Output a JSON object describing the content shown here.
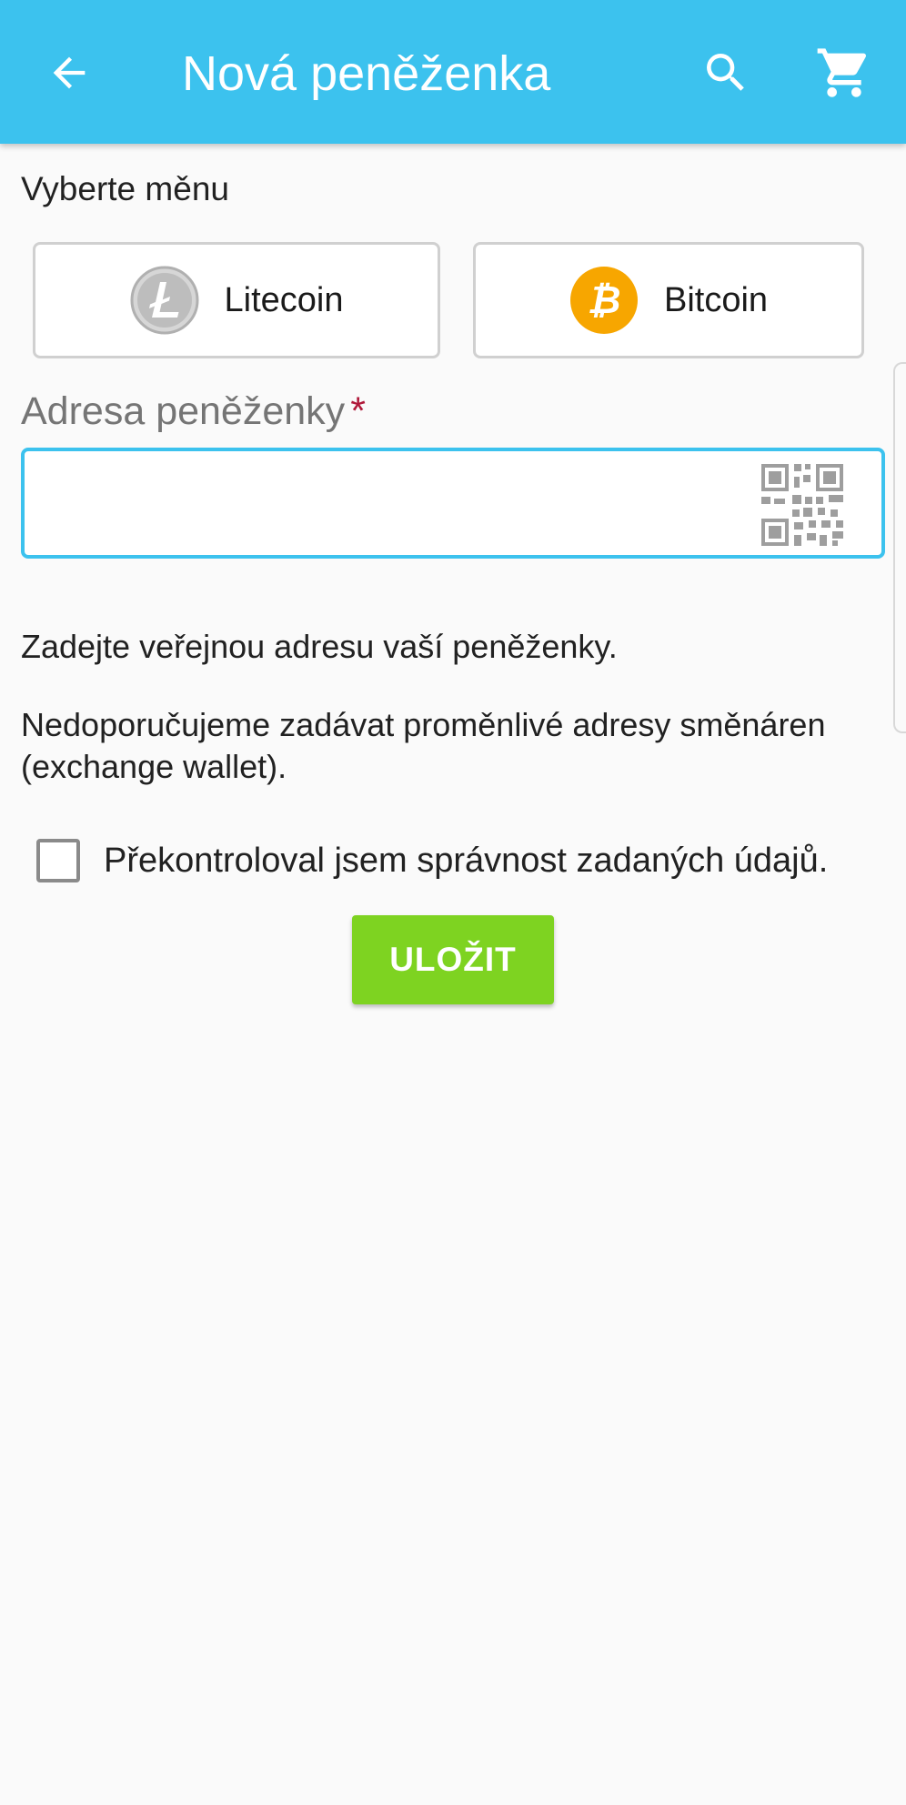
{
  "header": {
    "title": "Nová peněženka",
    "background_color": "#3cc2ee",
    "back_icon": "arrow-left-icon",
    "search_icon": "search-icon",
    "cart_icon": "cart-icon"
  },
  "currency_select": {
    "label": "Vyberte měnu",
    "options": [
      {
        "label": "Litecoin",
        "icon": "litecoin-icon"
      },
      {
        "label": "Bitcoin",
        "icon": "bitcoin-icon"
      }
    ]
  },
  "address": {
    "label": "Adresa peněženky",
    "required_mark": "*",
    "value": "",
    "placeholder": "",
    "qr_icon": "qr-code-icon",
    "accent_color": "#3cc2ee"
  },
  "help": {
    "line1": "Zadejte veřejnou adresu vaší peněženky.",
    "line2": "Nedoporučujeme zadávat proměnlivé adresy směnáren (exchange wallet)."
  },
  "confirm": {
    "checked": false,
    "label": "Překontroloval jsem správnost zadaných údajů."
  },
  "actions": {
    "save_label": "ULOŽIT",
    "save_color": "#7ed321"
  }
}
